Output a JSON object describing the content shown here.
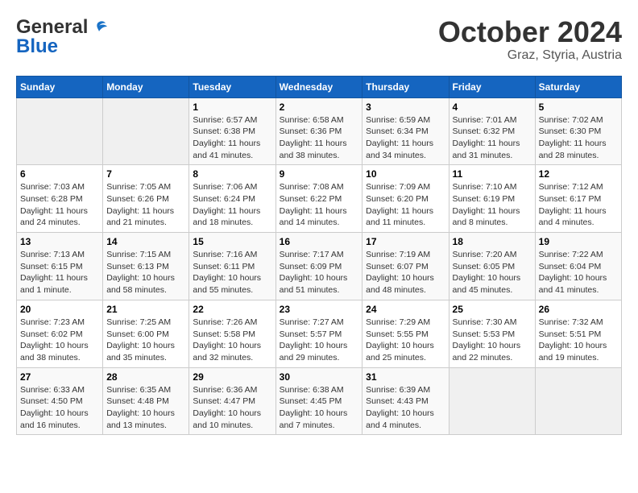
{
  "logo": {
    "line1": "General",
    "line2": "Blue"
  },
  "title": "October 2024",
  "subtitle": "Graz, Styria, Austria",
  "weekdays": [
    "Sunday",
    "Monday",
    "Tuesday",
    "Wednesday",
    "Thursday",
    "Friday",
    "Saturday"
  ],
  "weeks": [
    [
      {
        "day": "",
        "empty": true
      },
      {
        "day": "",
        "empty": true
      },
      {
        "day": "1",
        "sunrise": "6:57 AM",
        "sunset": "6:38 PM",
        "daylight": "11 hours and 41 minutes."
      },
      {
        "day": "2",
        "sunrise": "6:58 AM",
        "sunset": "6:36 PM",
        "daylight": "11 hours and 38 minutes."
      },
      {
        "day": "3",
        "sunrise": "6:59 AM",
        "sunset": "6:34 PM",
        "daylight": "11 hours and 34 minutes."
      },
      {
        "day": "4",
        "sunrise": "7:01 AM",
        "sunset": "6:32 PM",
        "daylight": "11 hours and 31 minutes."
      },
      {
        "day": "5",
        "sunrise": "7:02 AM",
        "sunset": "6:30 PM",
        "daylight": "11 hours and 28 minutes."
      }
    ],
    [
      {
        "day": "6",
        "sunrise": "7:03 AM",
        "sunset": "6:28 PM",
        "daylight": "11 hours and 24 minutes."
      },
      {
        "day": "7",
        "sunrise": "7:05 AM",
        "sunset": "6:26 PM",
        "daylight": "11 hours and 21 minutes."
      },
      {
        "day": "8",
        "sunrise": "7:06 AM",
        "sunset": "6:24 PM",
        "daylight": "11 hours and 18 minutes."
      },
      {
        "day": "9",
        "sunrise": "7:08 AM",
        "sunset": "6:22 PM",
        "daylight": "11 hours and 14 minutes."
      },
      {
        "day": "10",
        "sunrise": "7:09 AM",
        "sunset": "6:20 PM",
        "daylight": "11 hours and 11 minutes."
      },
      {
        "day": "11",
        "sunrise": "7:10 AM",
        "sunset": "6:19 PM",
        "daylight": "11 hours and 8 minutes."
      },
      {
        "day": "12",
        "sunrise": "7:12 AM",
        "sunset": "6:17 PM",
        "daylight": "11 hours and 4 minutes."
      }
    ],
    [
      {
        "day": "13",
        "sunrise": "7:13 AM",
        "sunset": "6:15 PM",
        "daylight": "11 hours and 1 minute."
      },
      {
        "day": "14",
        "sunrise": "7:15 AM",
        "sunset": "6:13 PM",
        "daylight": "10 hours and 58 minutes."
      },
      {
        "day": "15",
        "sunrise": "7:16 AM",
        "sunset": "6:11 PM",
        "daylight": "10 hours and 55 minutes."
      },
      {
        "day": "16",
        "sunrise": "7:17 AM",
        "sunset": "6:09 PM",
        "daylight": "10 hours and 51 minutes."
      },
      {
        "day": "17",
        "sunrise": "7:19 AM",
        "sunset": "6:07 PM",
        "daylight": "10 hours and 48 minutes."
      },
      {
        "day": "18",
        "sunrise": "7:20 AM",
        "sunset": "6:05 PM",
        "daylight": "10 hours and 45 minutes."
      },
      {
        "day": "19",
        "sunrise": "7:22 AM",
        "sunset": "6:04 PM",
        "daylight": "10 hours and 41 minutes."
      }
    ],
    [
      {
        "day": "20",
        "sunrise": "7:23 AM",
        "sunset": "6:02 PM",
        "daylight": "10 hours and 38 minutes."
      },
      {
        "day": "21",
        "sunrise": "7:25 AM",
        "sunset": "6:00 PM",
        "daylight": "10 hours and 35 minutes."
      },
      {
        "day": "22",
        "sunrise": "7:26 AM",
        "sunset": "5:58 PM",
        "daylight": "10 hours and 32 minutes."
      },
      {
        "day": "23",
        "sunrise": "7:27 AM",
        "sunset": "5:57 PM",
        "daylight": "10 hours and 29 minutes."
      },
      {
        "day": "24",
        "sunrise": "7:29 AM",
        "sunset": "5:55 PM",
        "daylight": "10 hours and 25 minutes."
      },
      {
        "day": "25",
        "sunrise": "7:30 AM",
        "sunset": "5:53 PM",
        "daylight": "10 hours and 22 minutes."
      },
      {
        "day": "26",
        "sunrise": "7:32 AM",
        "sunset": "5:51 PM",
        "daylight": "10 hours and 19 minutes."
      }
    ],
    [
      {
        "day": "27",
        "sunrise": "6:33 AM",
        "sunset": "4:50 PM",
        "daylight": "10 hours and 16 minutes."
      },
      {
        "day": "28",
        "sunrise": "6:35 AM",
        "sunset": "4:48 PM",
        "daylight": "10 hours and 13 minutes."
      },
      {
        "day": "29",
        "sunrise": "6:36 AM",
        "sunset": "4:47 PM",
        "daylight": "10 hours and 10 minutes."
      },
      {
        "day": "30",
        "sunrise": "6:38 AM",
        "sunset": "4:45 PM",
        "daylight": "10 hours and 7 minutes."
      },
      {
        "day": "31",
        "sunrise": "6:39 AM",
        "sunset": "4:43 PM",
        "daylight": "10 hours and 4 minutes."
      },
      {
        "day": "",
        "empty": true
      },
      {
        "day": "",
        "empty": true
      }
    ]
  ]
}
